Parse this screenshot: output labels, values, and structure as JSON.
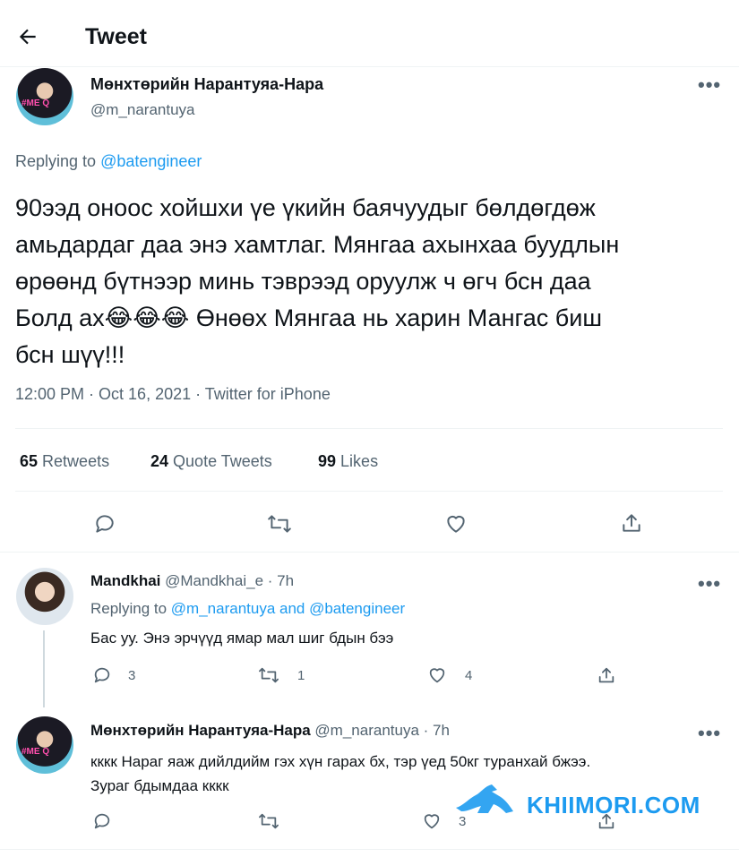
{
  "header": {
    "back_icon": "arrow-left-icon",
    "title": "Tweet"
  },
  "main_tweet": {
    "display_name": "Мөнхтөрийн Нарантуяа-Нара",
    "handle": "@m_narantuya",
    "avatar_text": "#ME Q",
    "replying_prefix": "Replying to",
    "replying_to": "@batengineer",
    "text_lines": [
      "90ээд оноос хойшхи үе үкийн баячуудыг бөлдөгдөж",
      "амьдардаг даа энэ хамтлаг. Мянгаа ахынхаа буудлын",
      "өрөөнд бүтнээр минь тэврээд оруулж ч өгч бсн даа",
      "Болд ах😂😂😂 Өнөөх Мянгаа нь харин Мангас биш",
      "бсн шүү!!!"
    ],
    "meta": "12:00 PM · Oct 16, 2021 · Twitter for iPhone",
    "stats": {
      "retweets_count": "65",
      "retweets_label": "Retweets",
      "quotes_count": "24",
      "quotes_label": "Quote Tweets",
      "likes_count": "99",
      "likes_label": "Likes"
    },
    "actions": [
      "reply-icon",
      "retweet-icon",
      "like-icon",
      "share-icon"
    ]
  },
  "replies": [
    {
      "display_name": "Mandkhai",
      "handle_time": "@Mandkhai_e · 7h",
      "replying_prefix": "Replying to",
      "replying_to": "@m_narantuya and @batengineer",
      "text": "Бас уу. Энэ эрчүүд ямар мал шиг бдын бээ",
      "reply_count": "3",
      "retweet_count": "1",
      "like_count": "4"
    },
    {
      "display_name": "Мөнхтөрийн Нарантуяа-Нара",
      "handle_time": "@m_narantuya · 7h",
      "text_line1": "кккк Нараг яаж дийлдийм гэх хүн гарах бх, тэр үед 50кг туранхай бжээ.",
      "text_line2": "Зураг бдымдаа кккк",
      "like_count": "3"
    }
  ],
  "watermark": {
    "text": "KHIIMORI.COM",
    "color": "#1d9bf0"
  }
}
